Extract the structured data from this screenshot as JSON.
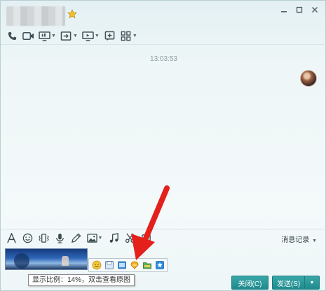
{
  "window": {
    "controls": [
      "minimize-icon",
      "maximize-icon",
      "close-icon"
    ]
  },
  "toolbar_top": {
    "items": [
      "phone-icon",
      "video-icon",
      "screen-share-icon",
      "file-transfer-icon",
      "remote-desktop-icon",
      "add-chat-icon",
      "apps-icon"
    ]
  },
  "chat": {
    "timestamp": "13:03:53"
  },
  "toolbar_bottom": {
    "items": [
      "font-icon",
      "emoji-icon",
      "shake-icon",
      "voice-icon",
      "pen-icon",
      "image-icon",
      "music-icon",
      "scissors-icon",
      "screenshot-icon"
    ],
    "history_label": "消息记录"
  },
  "image_toolbar": {
    "items": [
      "emoji-add-icon",
      "save-icon",
      "preview-icon",
      "edit-icon",
      "folder-icon",
      "collect-icon"
    ]
  },
  "tooltip": {
    "text": "显示比例：14%，双击查看原图"
  },
  "buttons": {
    "close_label": "关闭(C)",
    "send_label": "发送(S)",
    "send_arrow": "▼"
  },
  "colors": {
    "accent": "#1f8a8d",
    "annotation_arrow": "#e3201b"
  }
}
